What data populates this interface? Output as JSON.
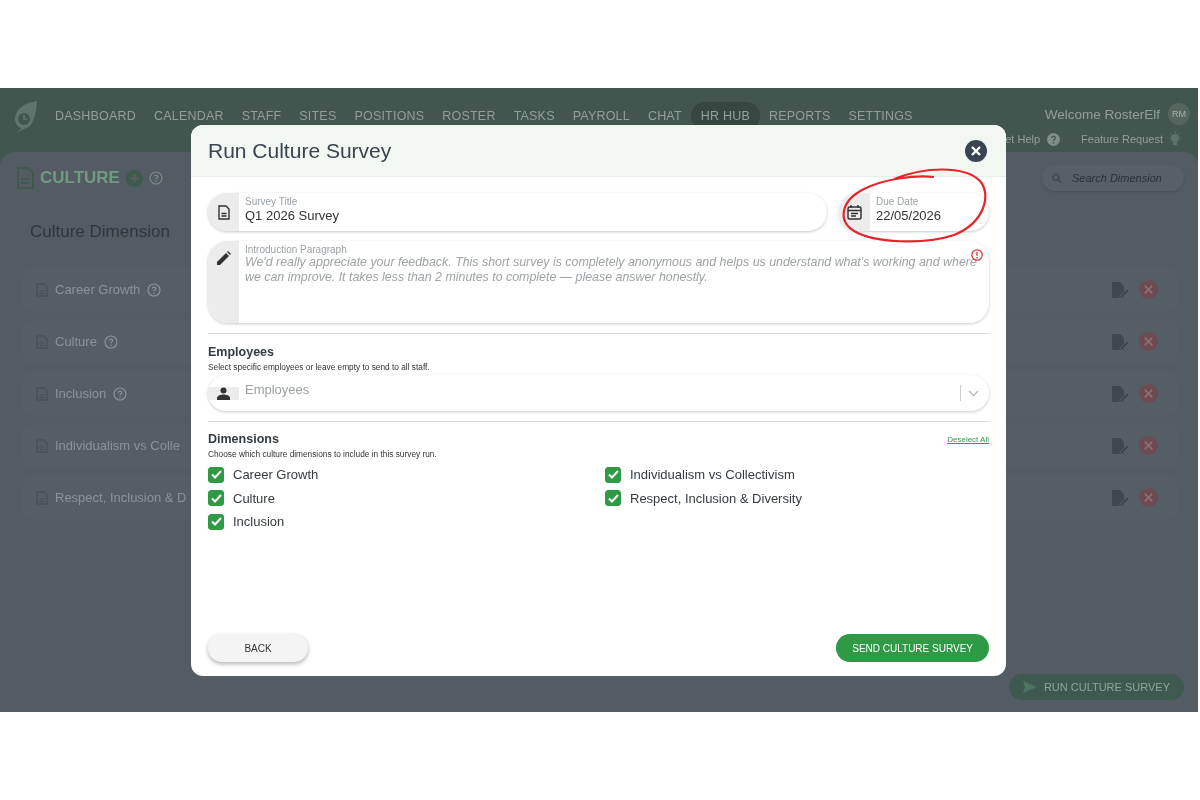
{
  "nav": {
    "items": [
      {
        "label": "DASHBOARD",
        "selected": false
      },
      {
        "label": "CALENDAR",
        "selected": false
      },
      {
        "label": "STAFF",
        "selected": false
      },
      {
        "label": "SITES",
        "selected": false
      },
      {
        "label": "POSITIONS",
        "selected": false
      },
      {
        "label": "ROSTER",
        "selected": false
      },
      {
        "label": "TASKS",
        "selected": false
      },
      {
        "label": "PAYROLL",
        "selected": false
      },
      {
        "label": "CHAT",
        "selected": false
      },
      {
        "label": "HR HUB",
        "selected": true
      },
      {
        "label": "REPORTS",
        "selected": false
      },
      {
        "label": "SETTINGS",
        "selected": false
      }
    ],
    "welcome": "Welcome RosterElf",
    "avatar": "RM",
    "help_link": "et Help",
    "feature_link": "Feature Request"
  },
  "page": {
    "title": "CULTURE",
    "search_placeholder": "Search Dimension",
    "section_title": "Culture Dimension",
    "rows": [
      {
        "label": "Career Growth",
        "help": true
      },
      {
        "label": "Culture",
        "help": true
      },
      {
        "label": "Inclusion",
        "help": true
      },
      {
        "label": "Individualism vs Colle",
        "help": false
      },
      {
        "label": "Respect, Inclusion & D",
        "help": false
      }
    ],
    "run_button": "RUN CULTURE SURVEY"
  },
  "modal": {
    "title": "Run Culture Survey",
    "survey_title": {
      "label": "Survey Title",
      "value": "Q1 2026 Survey"
    },
    "due_date": {
      "label": "Due Date",
      "value": "22/05/2026"
    },
    "introduction": {
      "label": "Introduction Paragraph",
      "placeholder": "We'd really appreciate your feedback. This short survey is completely anonymous and helps us understand what's working and where we can improve. It takes less than 2 minutes to complete — please answer honestly.",
      "error": true
    },
    "employees": {
      "heading": "Employees",
      "hint": "Select specific employees or leave empty to send to all staff.",
      "placeholder": "Employees"
    },
    "dimensions": {
      "heading": "Dimensions",
      "deselect_all": "Deselect All",
      "hint": "Choose which culture dimensions to include in this survey run.",
      "items": [
        {
          "label": "Career Growth",
          "checked": true
        },
        {
          "label": "Culture",
          "checked": true
        },
        {
          "label": "Inclusion",
          "checked": true
        },
        {
          "label": "Individualism vs Collectivism",
          "checked": true
        },
        {
          "label": "Respect, Inclusion & Diversity",
          "checked": true
        }
      ]
    },
    "back_button": "BACK",
    "send_button": "SEND CULTURE SURVEY"
  }
}
